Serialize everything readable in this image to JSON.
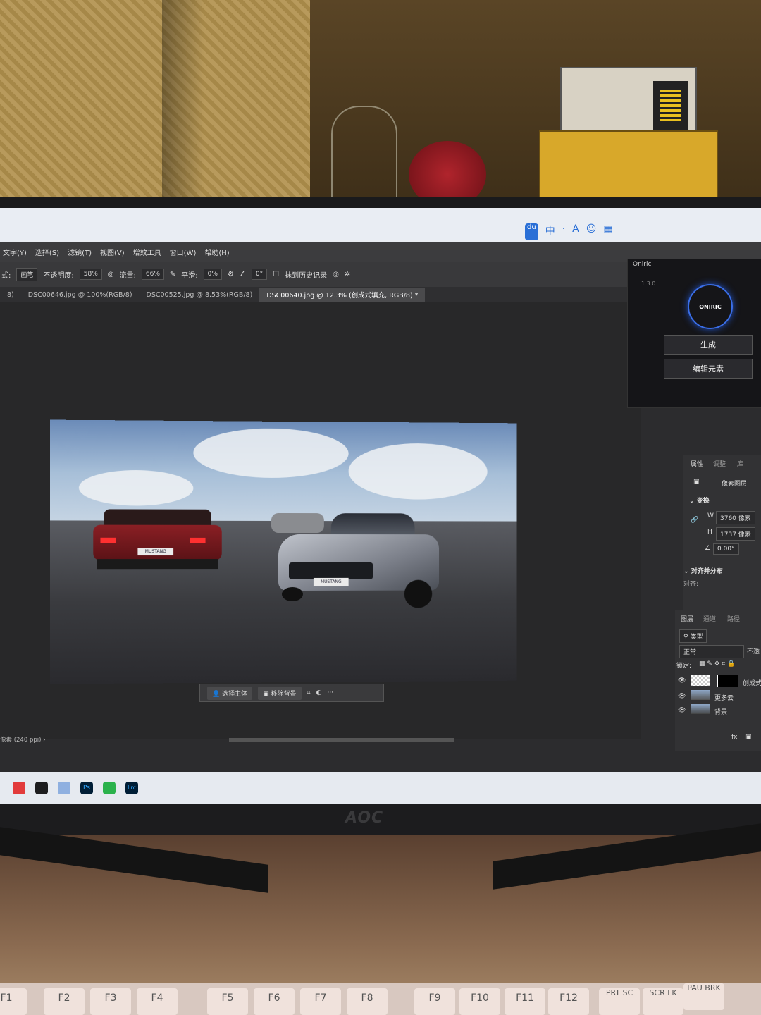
{
  "tray": {
    "icons": [
      "du",
      "中",
      "·",
      "A",
      "bot",
      "grid"
    ]
  },
  "menubar": {
    "items": [
      "文字(Y)",
      "选择(S)",
      "滤镜(T)",
      "视图(V)",
      "增效工具",
      "窗口(W)",
      "帮助(H)"
    ]
  },
  "options": {
    "mode_label": "式:",
    "mode_value": "画笔",
    "opacity_label": "不透明度:",
    "opacity_value": "58%",
    "flow_label": "流量:",
    "flow_value": "66%",
    "smooth_label": "平滑:",
    "smooth_value": "0%",
    "angle_value": "0°",
    "history_label": "抹到历史记录"
  },
  "tabs": [
    {
      "label": "8)"
    },
    {
      "label": "DSC00646.jpg @ 100%(RGB/8)"
    },
    {
      "label": "DSC00525.jpg @ 8.53%(RGB/8)"
    },
    {
      "label": "DSC00640.jpg @ 12.3% (创成式填充, RGB/8) *"
    }
  ],
  "photo": {
    "plate_back": "MUSTANG",
    "plate_front": "MUSTANG"
  },
  "contextbar": {
    "select_subject": "选择主体",
    "remove_bg": "移除背景"
  },
  "status": {
    "text": "像素 (240 ppi)"
  },
  "oniric": {
    "title": "Oniric",
    "version": "1.3.0",
    "logo": "ONIRIC",
    "generate": "生成",
    "edit": "编辑元素"
  },
  "properties": {
    "tabs": [
      "属性",
      "调整",
      "库"
    ],
    "type": "像素图层",
    "transform_label": "变换",
    "w_label": "W",
    "w_value": "3760 像素",
    "h_label": "H",
    "h_value": "1737 像素",
    "angle": "0.00°",
    "align_label": "对齐并分布",
    "align_sub": "对齐:"
  },
  "layers": {
    "tabs": [
      "图层",
      "通道",
      "路径"
    ],
    "filter": "类型",
    "blend": "正常",
    "opacity": "不透",
    "lock_label": "锁定:",
    "items": [
      {
        "name": "创成式"
      },
      {
        "name": "更多云"
      },
      {
        "name": "背景"
      }
    ]
  },
  "taskbar": {
    "apps": [
      "netease",
      "music",
      "network",
      "Ps",
      "wechat",
      "Lrc"
    ]
  },
  "monitor": {
    "brand": "AOC"
  },
  "keys": [
    "F1",
    "F2",
    "F3",
    "F4",
    "F5",
    "F6",
    "F7",
    "F8",
    "F9",
    "F10",
    "F11",
    "F12",
    "PRT SC",
    "SCR LK",
    "PAU BRK"
  ],
  "colors": {
    "accent": "#3a6ee8",
    "ps_bg": "#2c2c2e",
    "panel": "#323234"
  }
}
